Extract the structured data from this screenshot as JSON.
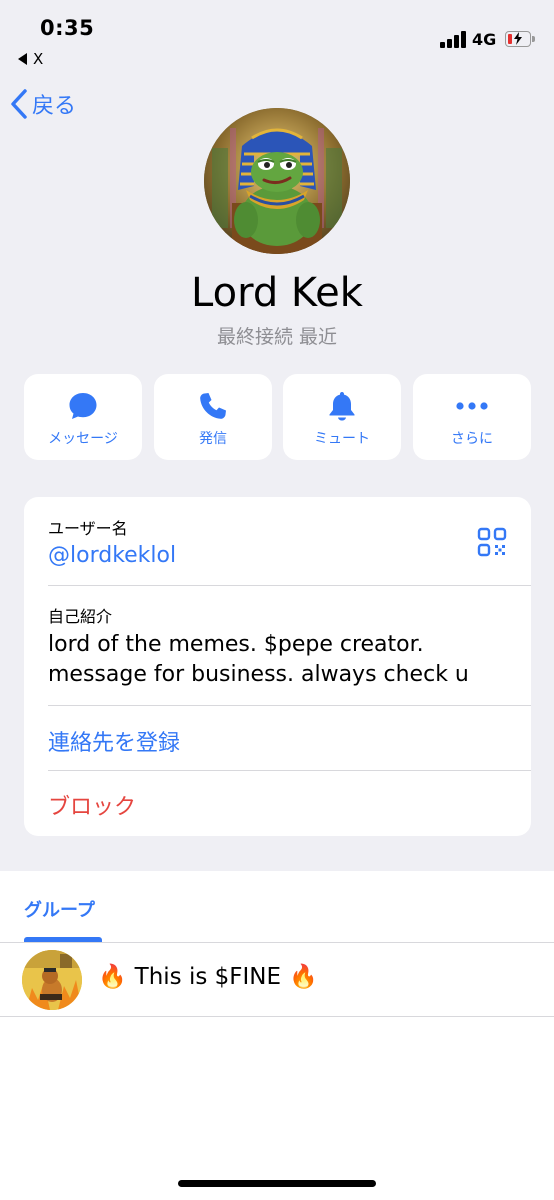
{
  "status_bar": {
    "time": "0:35",
    "back_app": "X",
    "network": "4G"
  },
  "nav": {
    "back_label": "戻る"
  },
  "profile": {
    "name": "Lord Kek",
    "last_seen": "最終接続 最近"
  },
  "actions": [
    {
      "label": "メッセージ",
      "icon": "message-icon"
    },
    {
      "label": "発信",
      "icon": "phone-icon"
    },
    {
      "label": "ミュート",
      "icon": "bell-icon"
    },
    {
      "label": "さらに",
      "icon": "more-icon"
    }
  ],
  "info": {
    "username_label": "ユーザー名",
    "username": "@lordkeklol",
    "bio_label": "自己紹介",
    "bio_line1": "lord of the memes. $pepe creator.",
    "bio_line2": "message for business. always check u",
    "add_contact": "連絡先を登録",
    "block": "ブロック"
  },
  "tabs": {
    "groups": "グループ"
  },
  "groups": [
    {
      "name": "This is $FINE",
      "emoji": "🔥"
    }
  ],
  "colors": {
    "accent": "#3478f6",
    "danger": "#e5453f",
    "background": "#efeff4"
  }
}
